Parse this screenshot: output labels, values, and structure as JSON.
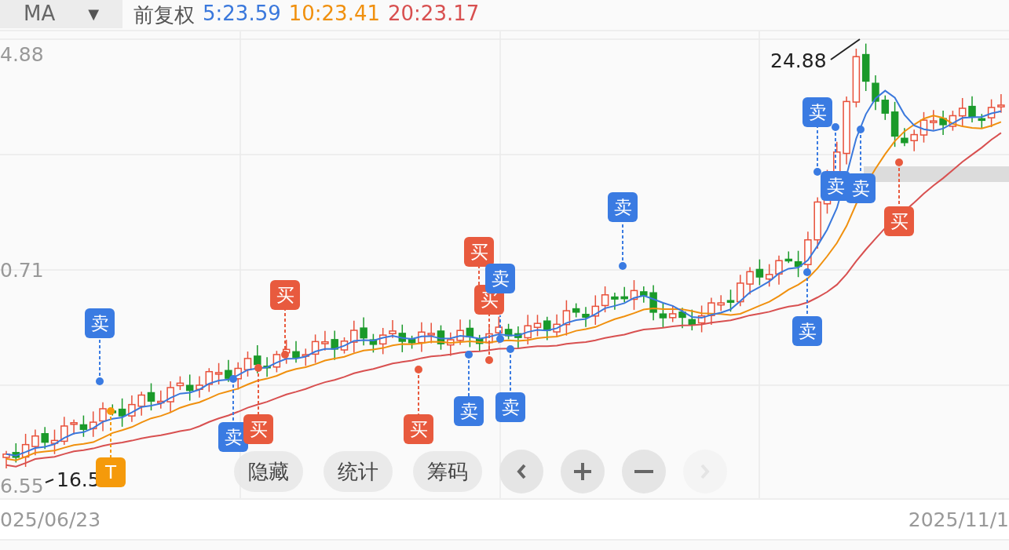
{
  "indicator": {
    "label": "MA",
    "caret": "▼"
  },
  "legend": {
    "adjust": "前复权",
    "items": [
      {
        "text": "5:23.59",
        "color": "#3a78dc"
      },
      {
        "text": "10:23.41",
        "color": "#f0900e"
      },
      {
        "text": "20:23.17",
        "color": "#d85050"
      }
    ]
  },
  "y_axis": [
    "4.88",
    "0.71",
    "6.55"
  ],
  "price_notes": [
    {
      "kind": "high",
      "text": "24.88"
    },
    {
      "kind": "low",
      "text": "16.5"
    }
  ],
  "markers": [
    {
      "kind": "sell",
      "label": "卖"
    },
    {
      "kind": "t",
      "label": "T"
    },
    {
      "kind": "sell",
      "label": "卖"
    },
    {
      "kind": "buy",
      "label": "买"
    },
    {
      "kind": "buy",
      "label": "买"
    },
    {
      "kind": "buy",
      "label": "买"
    },
    {
      "kind": "sell",
      "label": "卖"
    },
    {
      "kind": "buy",
      "label": "买"
    },
    {
      "kind": "buy",
      "label": "买"
    },
    {
      "kind": "sell",
      "label": "卖"
    },
    {
      "kind": "sell",
      "label": "卖"
    },
    {
      "kind": "sell",
      "label": "卖"
    },
    {
      "kind": "sell",
      "label": "卖"
    },
    {
      "kind": "sell",
      "label": "卖"
    },
    {
      "kind": "sell",
      "label": "卖"
    },
    {
      "kind": "sell",
      "label": "卖"
    },
    {
      "kind": "buy",
      "label": "买"
    }
  ],
  "toolbar": {
    "buttons": [
      "隐藏",
      "统计",
      "筹码"
    ],
    "icon_buttons": [
      {
        "kind": "prev",
        "disabled": false
      },
      {
        "kind": "plus",
        "disabled": false
      },
      {
        "kind": "minus",
        "disabled": false
      },
      {
        "kind": "next",
        "disabled": true
      }
    ]
  },
  "dates": [
    "025/06/23",
    "2025/11/1"
  ]
}
